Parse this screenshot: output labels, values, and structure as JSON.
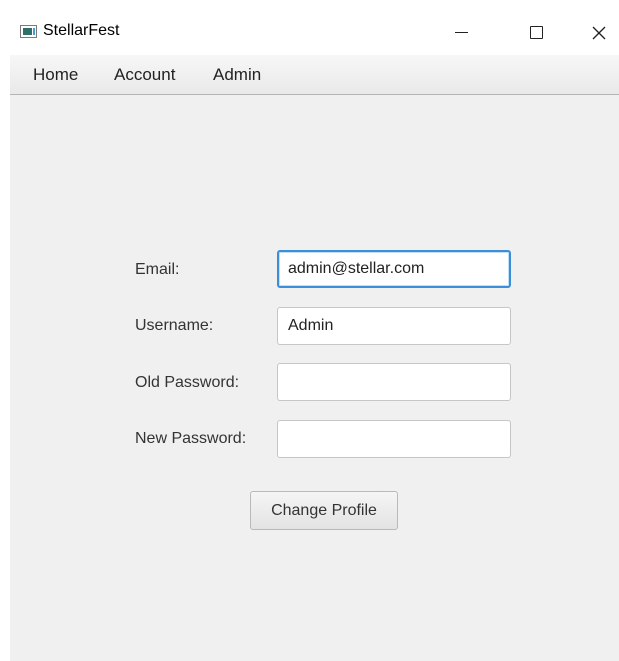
{
  "window": {
    "title": "StellarFest",
    "icon": "app-window-icon",
    "controls": {
      "minimize": "minimize-icon",
      "maximize": "maximize-icon",
      "close_glyph": "✕"
    }
  },
  "menu": {
    "items": [
      {
        "label": "Home"
      },
      {
        "label": "Account"
      },
      {
        "label": "Admin"
      }
    ]
  },
  "form": {
    "email_label": "Email:",
    "email_value": "admin@stellar.com",
    "username_label": "Username:",
    "username_value": "Admin",
    "old_password_label": "Old Password:",
    "old_password_value": "",
    "new_password_label": "New Password:",
    "new_password_value": "",
    "submit_label": "Change Profile"
  },
  "colors": {
    "background": "#f0f0f0",
    "focus_accent": "#3b8fd9"
  }
}
